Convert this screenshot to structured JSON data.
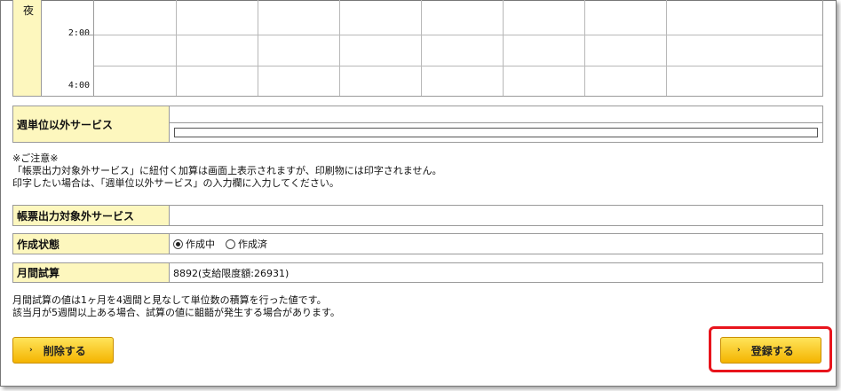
{
  "schedule": {
    "day_label": "夜",
    "times": [
      "2:00",
      "4:00"
    ]
  },
  "weekly_other_service": {
    "label": "週単位以外サービス",
    "input_value": ""
  },
  "caution": {
    "line1": "※ご注意※",
    "line2": "「帳票出力対象外サービス」に紐付く加算は画面上表示されますが、印刷物には印字されません。",
    "line3": "印字したい場合は、「週単位以外サービス」の入力欄に入力してください。"
  },
  "excluded_service": {
    "label": "帳票出力対象外サービス",
    "value": ""
  },
  "status": {
    "label": "作成状態",
    "options": [
      {
        "label": "作成中",
        "selected": true
      },
      {
        "label": "作成済",
        "selected": false
      }
    ]
  },
  "monthly_estimate": {
    "label": "月間試算",
    "value": "8892(支給限度額:26931)"
  },
  "estimate_note": {
    "line1": "月間試算の値は1ヶ月を4週間と見なして単位数の積算を行った値です。",
    "line2": "該当月が5週間以上ある場合、試算の値に齟齬が発生する場合があります。"
  },
  "buttons": {
    "delete": "削除する",
    "register": "登録する"
  },
  "colors": {
    "label_bg": "#fdf7be",
    "button_bg": "#f4b400",
    "highlight": "#e8141c"
  }
}
